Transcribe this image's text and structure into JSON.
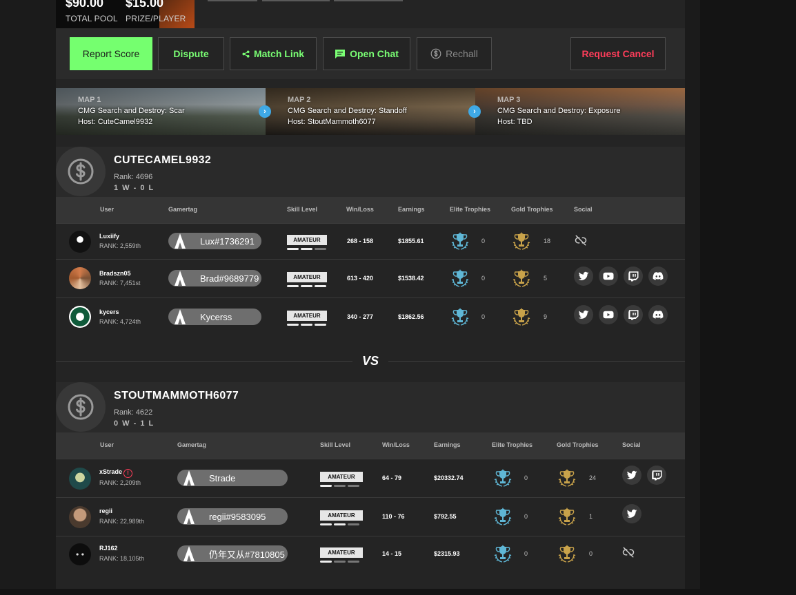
{
  "pool": {
    "total_amount": "$90.00",
    "total_label": "TOTAL POOL",
    "prize_amount": "$15.00",
    "prize_label": "PRIZE/PLAYER"
  },
  "actions": {
    "report": "Report Score",
    "dispute": "Dispute",
    "match_link": "Match Link",
    "open_chat": "Open Chat",
    "rechall": "Rechall",
    "request_cancel": "Request Cancel"
  },
  "maps": [
    {
      "num": "MAP 1",
      "name": "CMG Search and Destroy: Scar",
      "host": "Host: CuteCamel9932"
    },
    {
      "num": "MAP 2",
      "name": "CMG Search and Destroy: Standoff",
      "host": "Host: StoutMammoth6077"
    },
    {
      "num": "MAP 3",
      "name": "CMG Search and Destroy: Exposure",
      "host": "Host: TBD"
    }
  ],
  "columns": {
    "user": "User",
    "gamertag": "Gamertag",
    "skill": "Skill Level",
    "winloss": "Win/Loss",
    "earnings": "Earnings",
    "elite": "Elite Trophies",
    "gold": "Gold Trophies",
    "social": "Social"
  },
  "team1": {
    "name": "CUTECAMEL9932",
    "rank": "Rank: 4696",
    "record": "1 W - 0 L",
    "players": [
      {
        "name": "Luxiify",
        "rank": "RANK: 2,559th",
        "gamertag": "Lux#1736291",
        "skill": "AMATEUR",
        "winloss": "268 - 158",
        "earnings": "$1855.61",
        "elite": "0",
        "gold": "18"
      },
      {
        "name": "Bradszn05",
        "rank": "RANK: 7,451st",
        "gamertag": "Brad#9689779",
        "skill": "AMATEUR",
        "winloss": "613 - 420",
        "earnings": "$1538.42",
        "elite": "0",
        "gold": "5"
      },
      {
        "name": "kycers",
        "rank": "RANK: 4,724th",
        "gamertag": "Kycerss",
        "skill": "AMATEUR",
        "winloss": "340 - 277",
        "earnings": "$1862.56",
        "elite": "0",
        "gold": "9"
      }
    ]
  },
  "vs_label": "VS",
  "team2": {
    "name": "STOUTMAMMOTH6077",
    "rank": "Rank: 4622",
    "record": "0 W - 1 L",
    "players": [
      {
        "name": "xStrade",
        "rank": "RANK: 2,209th",
        "gamertag": "Strade",
        "skill": "AMATEUR",
        "winloss": "64 - 79",
        "earnings": "$20332.74",
        "elite": "0",
        "gold": "24"
      },
      {
        "name": "regii",
        "rank": "RANK: 22,989th",
        "gamertag": "regii#9583095",
        "skill": "AMATEUR",
        "winloss": "110 - 76",
        "earnings": "$792.55",
        "elite": "0",
        "gold": "1"
      },
      {
        "name": "RJ162",
        "rank": "RANK: 18,105th",
        "gamertag": "仍年又从#7810805",
        "skill": "AMATEUR",
        "winloss": "14 - 15",
        "earnings": "$2315.93",
        "elite": "0",
        "gold": "0"
      }
    ]
  },
  "colors": {
    "accent_green": "#75ff6f",
    "danger_red": "#ff3d5a",
    "info_blue": "#3fa9e6",
    "elite_trophy": "#5fb7d6",
    "gold_trophy": "#c8a24a"
  }
}
